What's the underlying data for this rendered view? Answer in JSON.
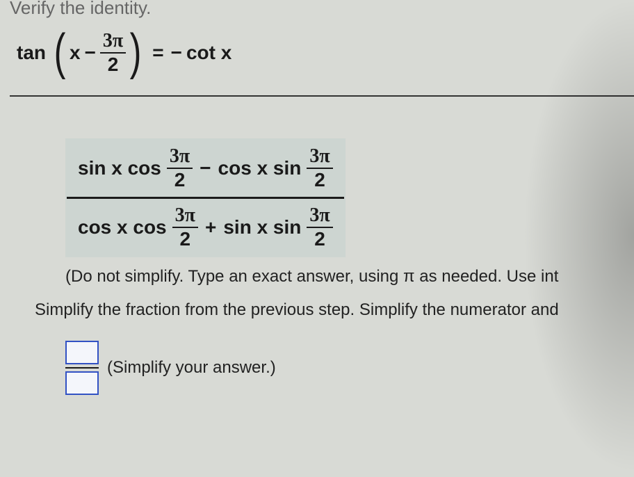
{
  "header": "Verify the identity.",
  "eq": {
    "tan": "tan",
    "x": "x",
    "minus": "−",
    "three_pi": "3π",
    "two": "2",
    "eq": "=",
    "neg": "−",
    "cotx": "cot x"
  },
  "bigfrac": {
    "num": {
      "p1": "sin x cos",
      "p2": "3π",
      "p3": "2",
      "op": "−",
      "p4": "cos x sin",
      "p5": "3π",
      "p6": "2"
    },
    "den": {
      "p1": "cos x cos",
      "p2": "3π",
      "p3": "2",
      "op": "+",
      "p4": "sin x sin",
      "p5": "3π",
      "p6": "2"
    }
  },
  "note": "(Do not simplify. Type an exact answer, using π as needed. Use int",
  "instr": "Simplify the fraction from the previous step. Simplify the numerator and",
  "answer_label": "(Simplify your answer.)"
}
